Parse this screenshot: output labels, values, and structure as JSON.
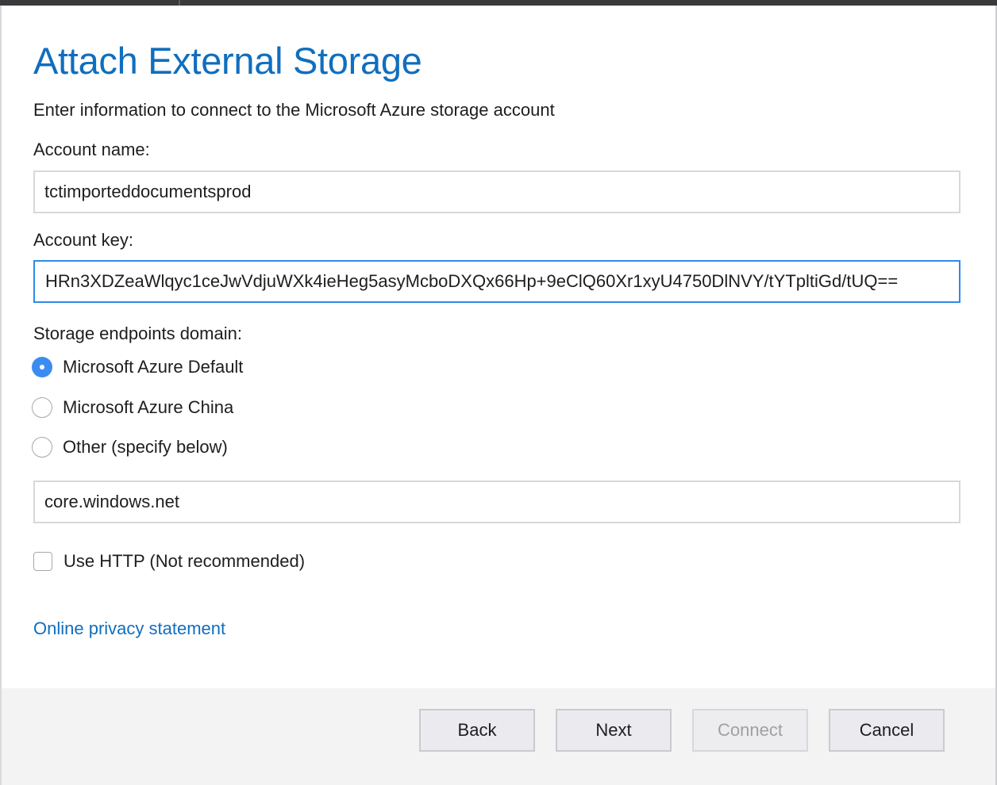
{
  "dialog": {
    "title": "Attach External Storage",
    "subtitle": "Enter information to connect to the Microsoft Azure storage account"
  },
  "account_name": {
    "label": "Account name:",
    "value": "tctimporteddocumentsprod"
  },
  "account_key": {
    "label": "Account key:",
    "value": "HRn3XDZeaWlqyc1ceJwVdjuWXk4ieHeg5asyMcboDXQx66Hp+9eClQ60Xr1xyU4750DlNVY/tYTpltiGd/tUQ=="
  },
  "endpoints": {
    "label": "Storage endpoints domain:",
    "options": [
      {
        "label": "Microsoft Azure Default",
        "selected": true
      },
      {
        "label": "Microsoft Azure China",
        "selected": false
      },
      {
        "label": "Other (specify below)",
        "selected": false
      }
    ],
    "domain_value": "core.windows.net"
  },
  "use_http": {
    "label": "Use HTTP (Not recommended)",
    "checked": false
  },
  "privacy_link": "Online privacy statement",
  "buttons": {
    "back": "Back",
    "next": "Next",
    "connect": "Connect",
    "cancel": "Cancel"
  },
  "colors": {
    "accent": "#106ebe",
    "radio_selected": "#3b8cf1",
    "focus_border": "#2f8ae8"
  }
}
